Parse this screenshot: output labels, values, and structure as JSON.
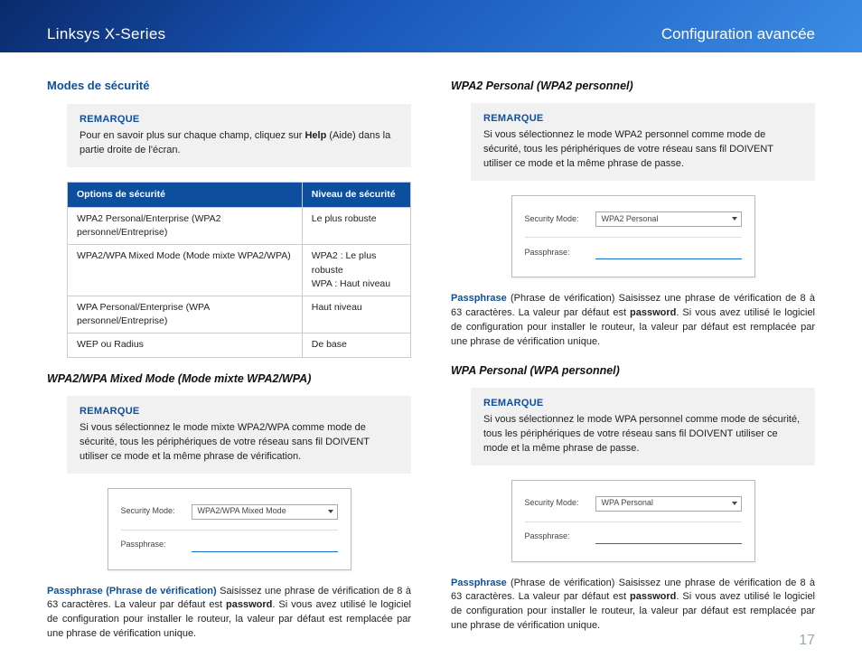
{
  "header": {
    "left": "Linksys X-Series",
    "right": "Configuration avancée"
  },
  "left": {
    "h_modes": "Modes de sécurité",
    "note1_title": "REMARQUE",
    "note1_body_a": "Pour en savoir plus sur chaque champ, cliquez sur ",
    "note1_help": "Help",
    "note1_body_b": " (Aide) dans la partie droite de l'écran.",
    "table": {
      "h1": "Options de sécurité",
      "h2": "Niveau de sécurité",
      "rows": [
        {
          "opt": "WPA2 Personal/Enterprise (WPA2 personnel/Entreprise)",
          "lvl": "Le plus robuste"
        },
        {
          "opt": "WPA2/WPA Mixed Mode (Mode mixte WPA2/WPA)",
          "lvl_a": "WPA2 : Le plus robuste",
          "lvl_b": "WPA : Haut niveau"
        },
        {
          "opt": "WPA Personal/Enterprise (WPA personnel/Entreprise)",
          "lvl": "Haut niveau"
        },
        {
          "opt": "WEP ou Radius",
          "lvl": "De base"
        }
      ]
    },
    "h_mixed": "WPA2/WPA Mixed Mode (Mode mixte WPA2/WPA)",
    "note2_title": "REMARQUE",
    "note2_body": "Si vous sélectionnez le mode mixte WPA2/WPA comme mode de sécurité, tous les périphériques de votre réseau sans fil DOIVENT utiliser ce mode et la même phrase de vérification.",
    "ui1": {
      "mode_lbl": "Security Mode:",
      "mode_val": "WPA2/WPA Mixed Mode",
      "pass_lbl": "Passphrase:"
    },
    "pass_term": "Passphrase (Phrase de vérification)",
    "pass_body_a": " Saisissez une phrase de vérification de 8 à 63 caractères. La valeur par défaut est ",
    "pass_bold": "password",
    "pass_body_b": ". Si vous avez utilisé le logiciel de configuration pour installer le routeur, la valeur par défaut est remplacée par une phrase de vérification unique."
  },
  "right": {
    "h_wpa2p": "WPA2 Personal (WPA2 personnel)",
    "note3_title": "REMARQUE",
    "note3_body": "Si vous sélectionnez le mode WPA2 personnel comme mode de sécurité, tous les périphériques de votre réseau sans fil DOIVENT utiliser ce mode et la même phrase de passe.",
    "ui2": {
      "mode_lbl": "Security Mode:",
      "mode_val": "WPA2 Personal",
      "pass_lbl": "Passphrase:"
    },
    "pass2_term": "Passphrase",
    "pass2_paren": " (Phrase de vérification)  ",
    "pass2_body_a": "Saisissez une phrase de vérification de 8 à 63 caractères. La valeur par défaut est ",
    "pass2_bold": "password",
    "pass2_body_b": ". Si vous avez utilisé le logiciel de configuration pour installer le routeur, la valeur par défaut est remplacée par une phrase de vérification unique.",
    "h_wpap": "WPA Personal (WPA personnel)",
    "note4_title": "REMARQUE",
    "note4_body": "Si vous sélectionnez le mode WPA personnel comme mode de sécurité, tous les périphériques de votre réseau sans fil DOIVENT utiliser ce mode et la même phrase de passe.",
    "ui3": {
      "mode_lbl": "Security Mode:",
      "mode_val": "WPA Personal",
      "pass_lbl": "Passphrase:"
    },
    "pass3_term": "Passphrase",
    "pass3_paren": " (Phrase de vérification)  ",
    "pass3_body_a": "Saisissez une phrase de vérification de 8 à 63 caractères. La valeur par défaut est ",
    "pass3_bold": "password",
    "pass3_body_b": ". Si vous avez utilisé le logiciel de configuration pour installer le routeur, la valeur par défaut est remplacée par une phrase de vérification unique."
  },
  "pagenum": "17"
}
